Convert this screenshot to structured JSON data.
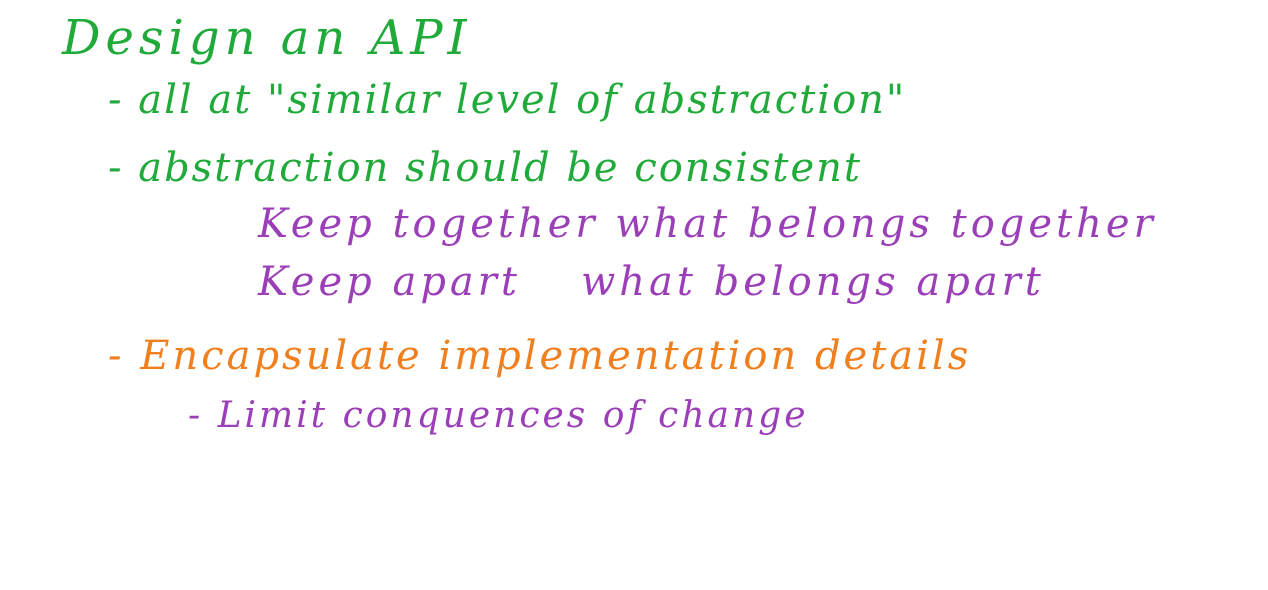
{
  "colors": {
    "green": "#1faa3a",
    "purple": "#9b3fb8",
    "orange": "#f07f1e",
    "background": "#ffffff"
  },
  "notes": {
    "title": "Design an API",
    "bullet_1": "- all at \"similar level of abstraction\"",
    "bullet_2": "- abstraction should be consistent",
    "sub_1": "Keep together what belongs together",
    "sub_2_part_1": "Keep apart",
    "sub_2_part_2": "what belongs apart",
    "bullet_3": "- Encapsulate implementation details",
    "sub_3": "- Limit conquences of change"
  }
}
